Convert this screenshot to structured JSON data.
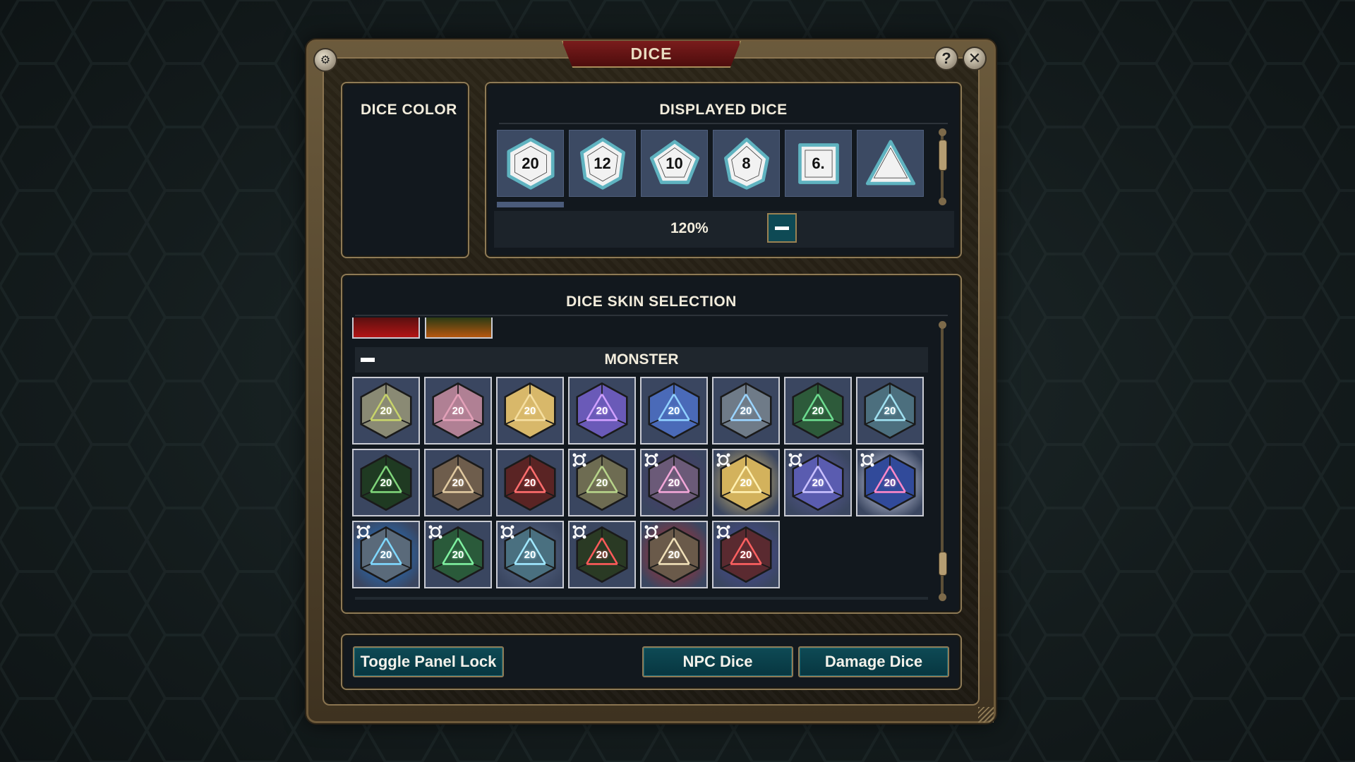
{
  "window": {
    "title": "DICE",
    "help_label": "?",
    "close_label": "✕"
  },
  "dice_color": {
    "title": "DICE COLOR"
  },
  "displayed_dice": {
    "title": "DISPLAYED DICE",
    "dice": [
      {
        "label": "20",
        "type": "d20"
      },
      {
        "label": "12",
        "type": "d12"
      },
      {
        "label": "10",
        "type": "d10"
      },
      {
        "label": "8",
        "type": "d8"
      },
      {
        "label": "6.",
        "type": "d6"
      },
      {
        "label": "",
        "type": "d4"
      }
    ],
    "zoom": "120%"
  },
  "skin_selection": {
    "title": "DICE SKIN SELECTION",
    "category": "MONSTER",
    "skins_row1": [
      "20",
      "20",
      "20",
      "20",
      "20",
      "20",
      "20",
      "20"
    ],
    "skins_row2": [
      "20",
      "20",
      "20",
      "20",
      "20",
      "20",
      "20",
      "20"
    ],
    "skins_row3": [
      "20",
      "20",
      "20",
      "20",
      "20",
      "20"
    ]
  },
  "footer": {
    "toggle_lock": "Toggle Panel Lock",
    "npc_dice": "NPC Dice",
    "damage_dice": "Damage Dice"
  },
  "colors": {
    "accent_teal": "#0e4a55",
    "frame_gold": "#8e7a55",
    "title_red": "#7a1c1c",
    "die_white": "#f2f2f2",
    "die_edge_teal": "#5fb3c0"
  }
}
